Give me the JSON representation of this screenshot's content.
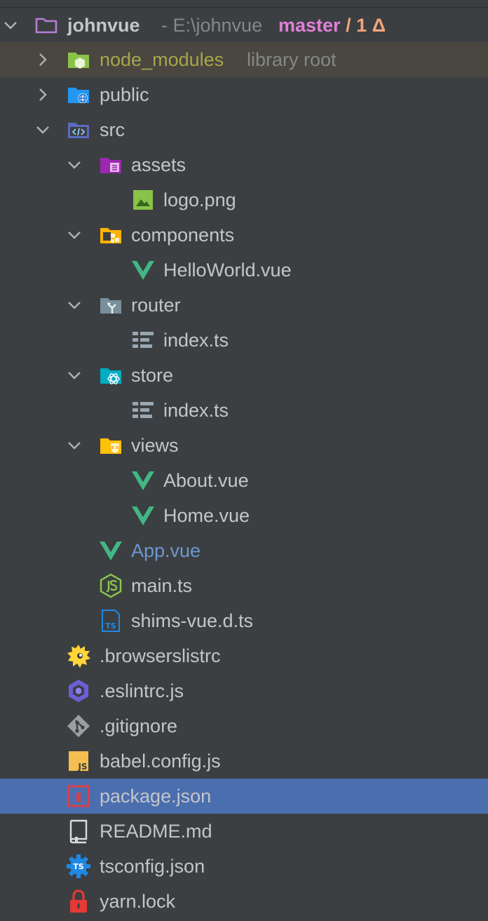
{
  "project": {
    "name": "johnvue",
    "path": "- E:\\johnvue",
    "branch": "master",
    "changes": "/ 1 Δ"
  },
  "tree": {
    "node_modules": {
      "label": "node_modules",
      "hint": "library root"
    },
    "public": "public",
    "src": "src",
    "assets": "assets",
    "logo": "logo.png",
    "components": "components",
    "hello_world": "HelloWorld.vue",
    "router": "router",
    "router_index": "index.ts",
    "store": "store",
    "store_index": "index.ts",
    "views": "views",
    "about": "About.vue",
    "home": "Home.vue",
    "app": "App.vue",
    "main": "main.ts",
    "shims": "shims-vue.d.ts",
    "browserslistrc": ".browserslistrc",
    "eslintrc": ".eslintrc.js",
    "gitignore": ".gitignore",
    "babel_config": "babel.config.js",
    "package_json": "package.json",
    "readme": "README.md",
    "tsconfig": "tsconfig.json",
    "yarn_lock": "yarn.lock"
  },
  "colors": {
    "background": "#3c3f41",
    "selection": "#4b6eaf",
    "library_row": "#49473f",
    "branch": "#e07fd6",
    "vue_green": "#41b883"
  }
}
